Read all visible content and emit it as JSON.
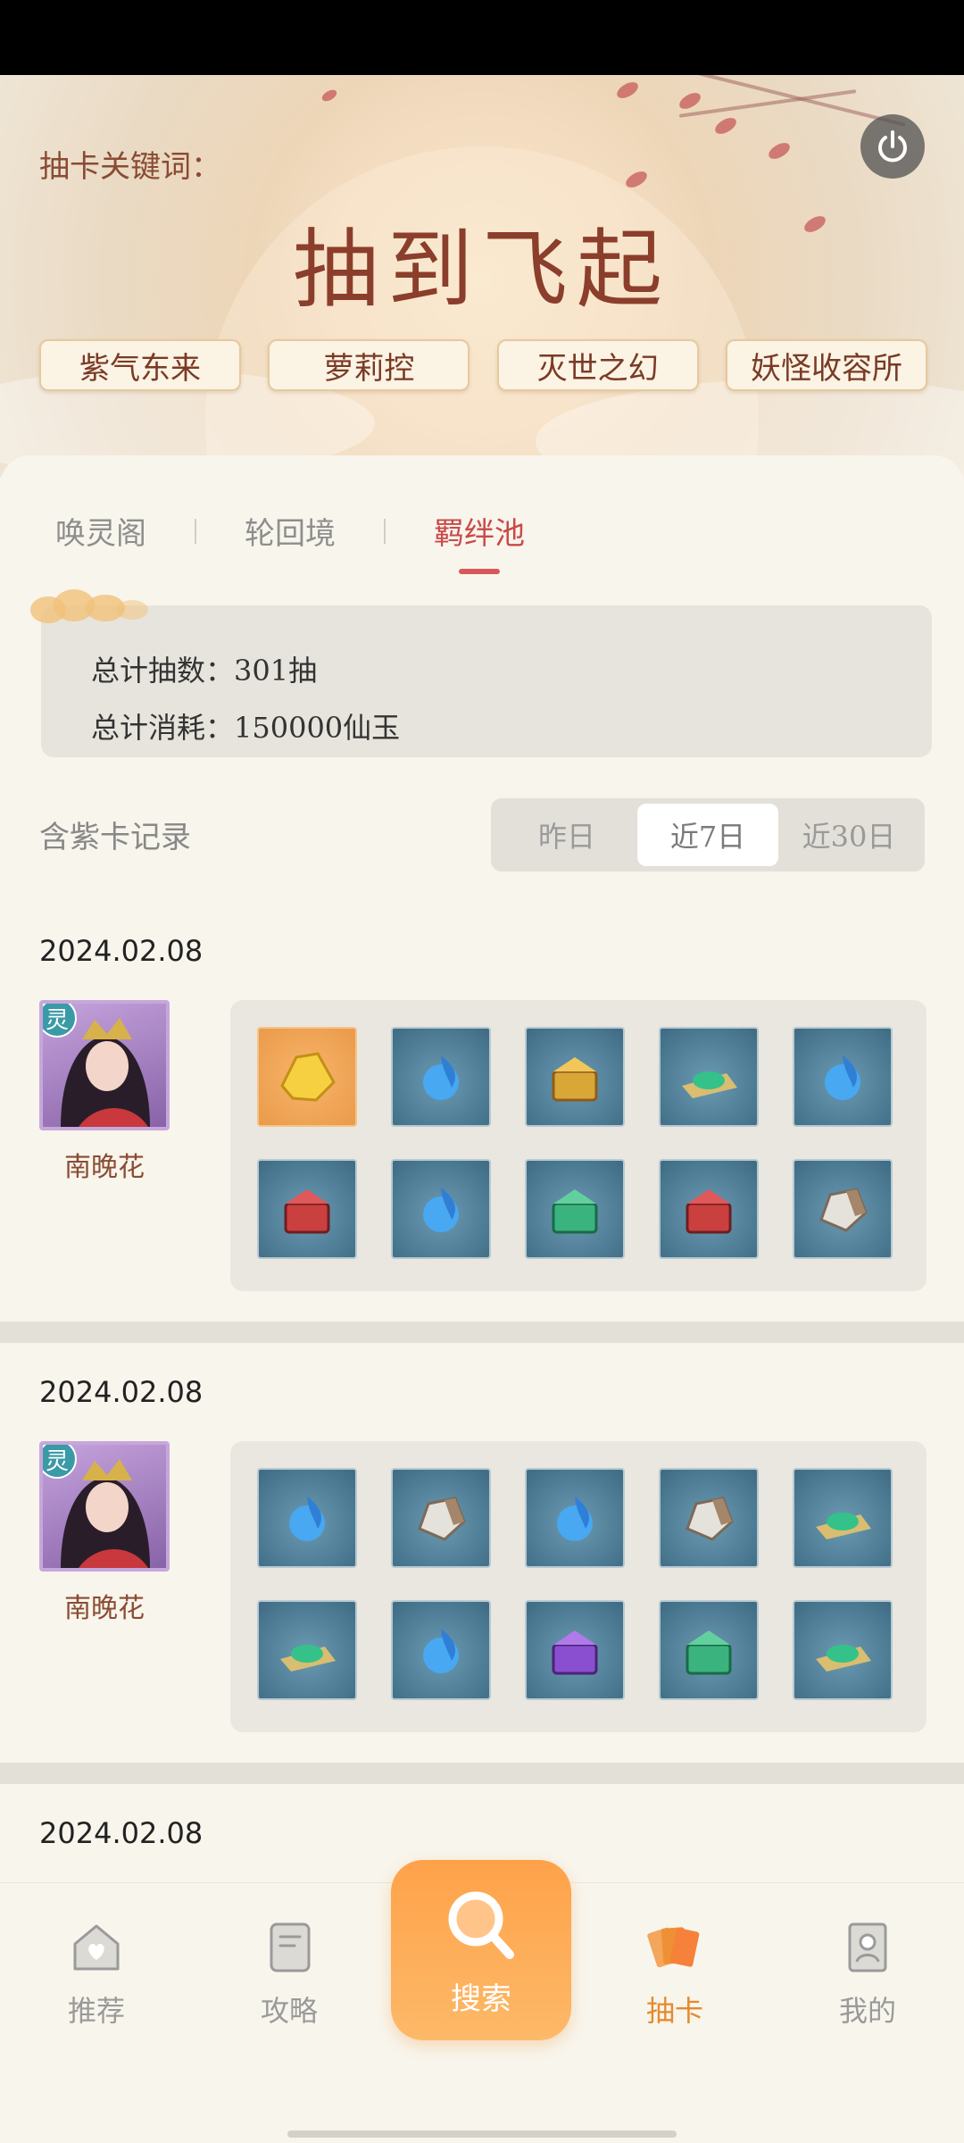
{
  "hero": {
    "keyword_label": "抽卡关键词：",
    "title": "抽到飞起",
    "tags": [
      "紫气东来",
      "萝莉控",
      "灭世之幻",
      "妖怪收容所"
    ]
  },
  "tabs": [
    {
      "label": "唤灵阁",
      "active": false
    },
    {
      "label": "轮回境",
      "active": false
    },
    {
      "label": "羁绊池",
      "active": true
    }
  ],
  "summary": {
    "total_draws": "总计抽数：301抽",
    "total_cost": "总计消耗：150000仙玉"
  },
  "filter": {
    "label": "含紫卡记录",
    "options": [
      "昨日",
      "近7日",
      "近30日"
    ],
    "selected": "近7日"
  },
  "records": [
    {
      "date": "2024.02.08",
      "character": "南晚花",
      "badge": "灵",
      "items": [
        "gold-ingot-icon",
        "blue-flame-icon",
        "golden-chest-icon",
        "jade-scroll-icon",
        "blue-flame-icon",
        "red-chest-icon",
        "blue-flame-icon",
        "green-chest-icon",
        "red-chest-icon",
        "stone-icon"
      ]
    },
    {
      "date": "2024.02.08",
      "character": "南晚花",
      "badge": "灵",
      "items": [
        "blue-flame-icon",
        "stone-icon",
        "blue-flame-icon",
        "stone-icon",
        "jade-scroll-icon",
        "jade-scroll-icon",
        "blue-flame-icon",
        "purple-chest-icon",
        "green-chest-icon",
        "jade-scroll-icon"
      ]
    },
    {
      "date": "2024.02.08"
    }
  ],
  "nav": [
    {
      "label": "推荐",
      "icon": "home-heart-icon"
    },
    {
      "label": "攻略",
      "icon": "book-icon"
    },
    {
      "label": "搜索",
      "icon": "search-icon"
    },
    {
      "label": "抽卡",
      "icon": "cards-icon",
      "active": true
    },
    {
      "label": "我的",
      "icon": "profile-icon"
    }
  ],
  "colors": {
    "accent": "#e68a2c",
    "tab_active": "#c94a49",
    "title": "#8b3e2b"
  }
}
